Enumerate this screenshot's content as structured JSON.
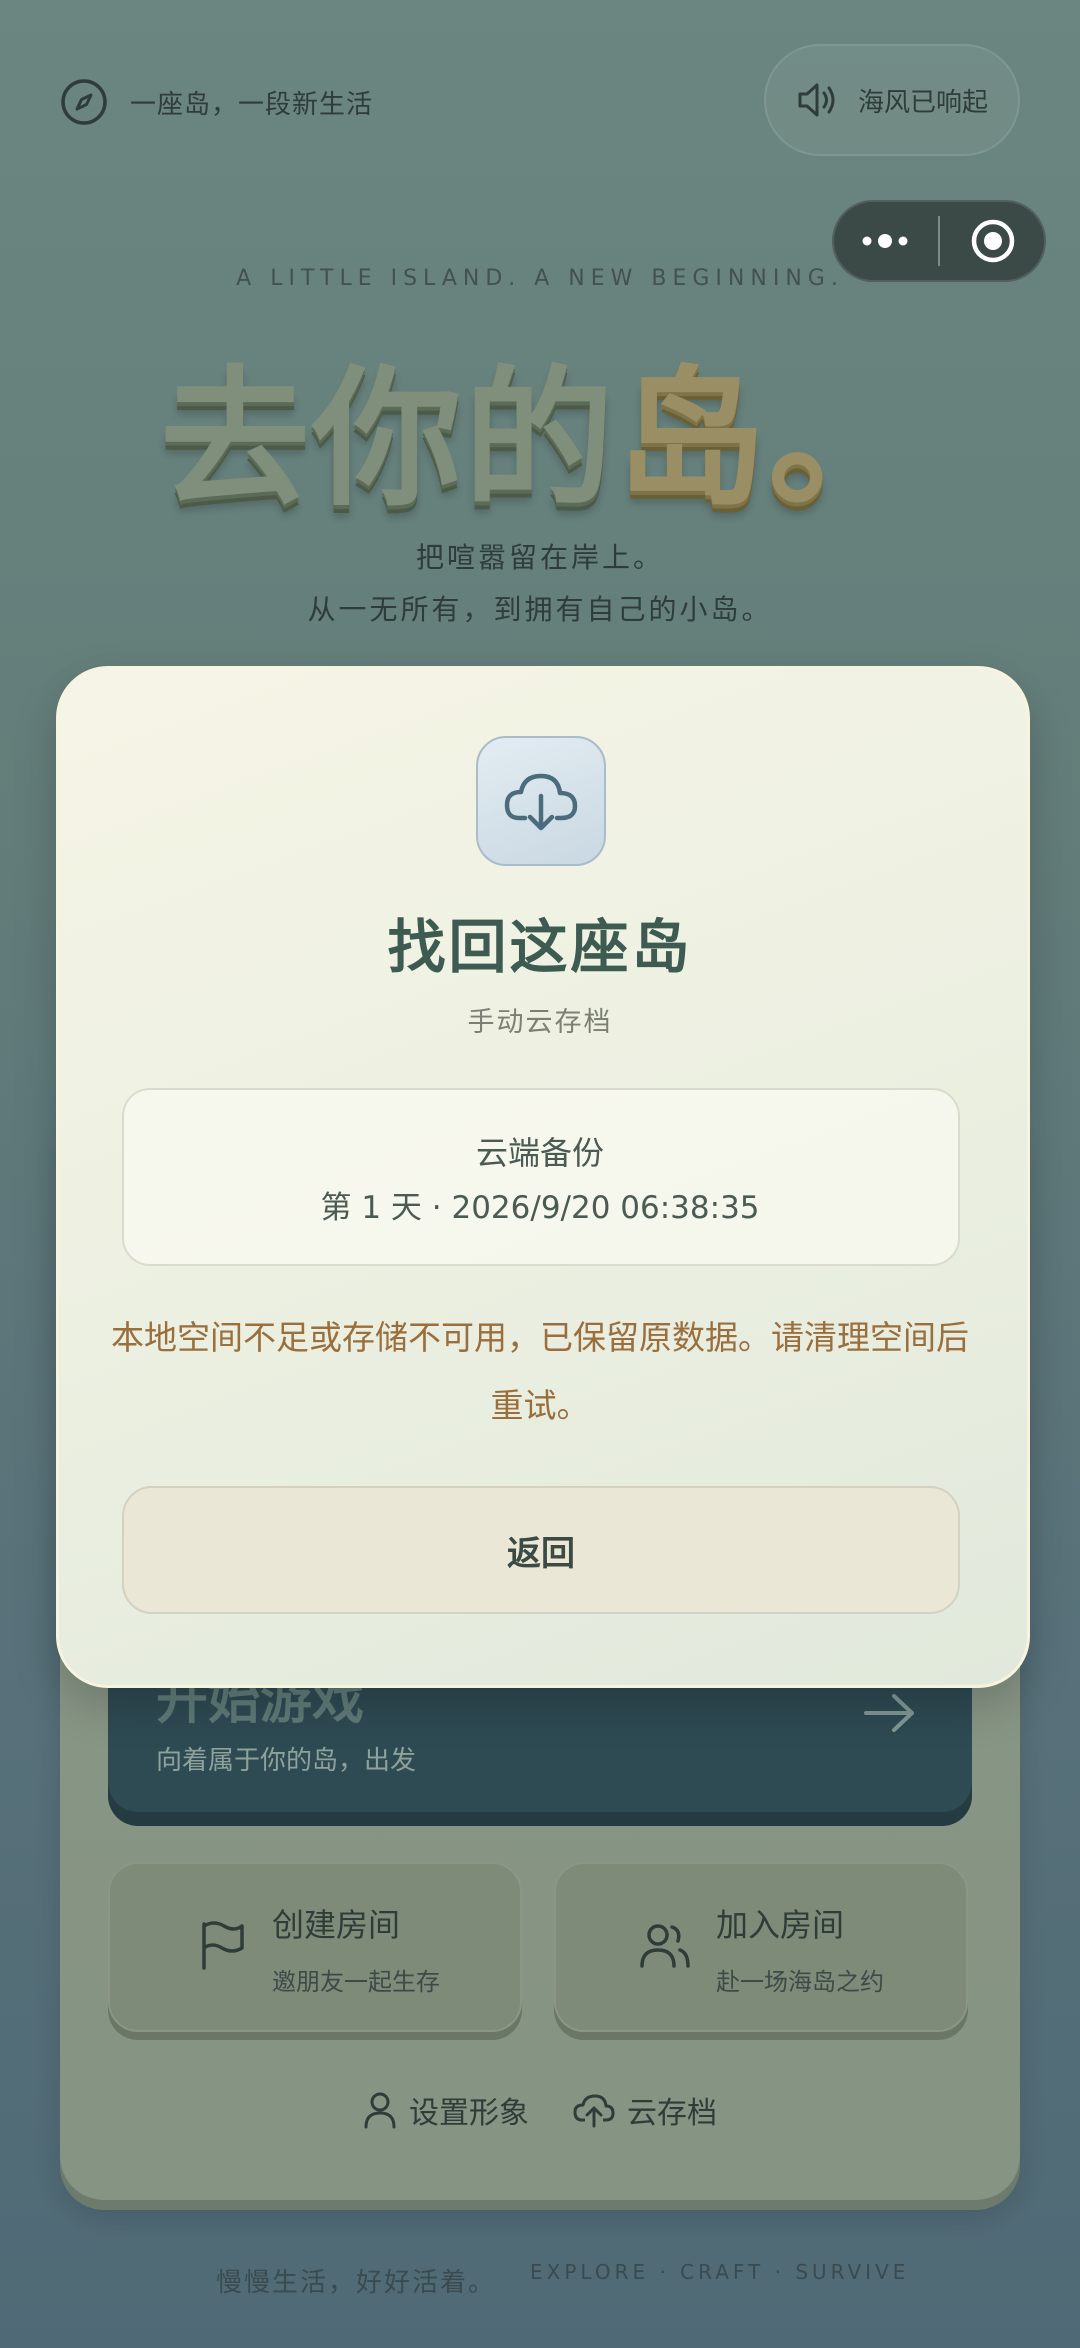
{
  "header": {
    "tagline": "一座岛，一段新生活",
    "sound_label": "海风已响起"
  },
  "hero": {
    "eyebrow": "A LITTLE ISLAND. A NEW BEGINNING.",
    "title_main": "去你的",
    "title_accent": "岛",
    "title_end": "。",
    "subtitle_line1": "把喧嚣留在岸上。",
    "subtitle_line2": "从一无所有，到拥有自己的小岛。"
  },
  "menu": {
    "start_title": "开始游戏",
    "start_sub": "向着属于你的岛，出发",
    "create_room_title": "创建房间",
    "create_room_sub": "邀朋友一起生存",
    "join_room_title": "加入房间",
    "join_room_sub": "赴一场海岛之约",
    "avatar_link": "设置形象",
    "cloud_link": "云存档"
  },
  "footer": {
    "left": "慢慢生活，好好活着。",
    "right": "EXPLORE · CRAFT · SURVIVE"
  },
  "modal": {
    "title": "找回这座岛",
    "subtitle": "手动云存档",
    "backup_label": "云端备份",
    "backup_info": "第 1 天 · 2026/9/20 06:38:35",
    "warning": "本地空间不足或存储不可用，已保留原数据。请清理空间后重试。",
    "back_button": "返回"
  },
  "icons": {
    "compass": "compass-icon",
    "sound": "speaker-icon",
    "more": "more-dots-icon",
    "close": "record-circle-icon",
    "cloud_download": "cloud-download-icon",
    "arrow": "arrow-right-icon",
    "flag": "flag-icon",
    "users": "users-icon",
    "user": "user-icon",
    "cloud_upload": "cloud-upload-icon"
  }
}
